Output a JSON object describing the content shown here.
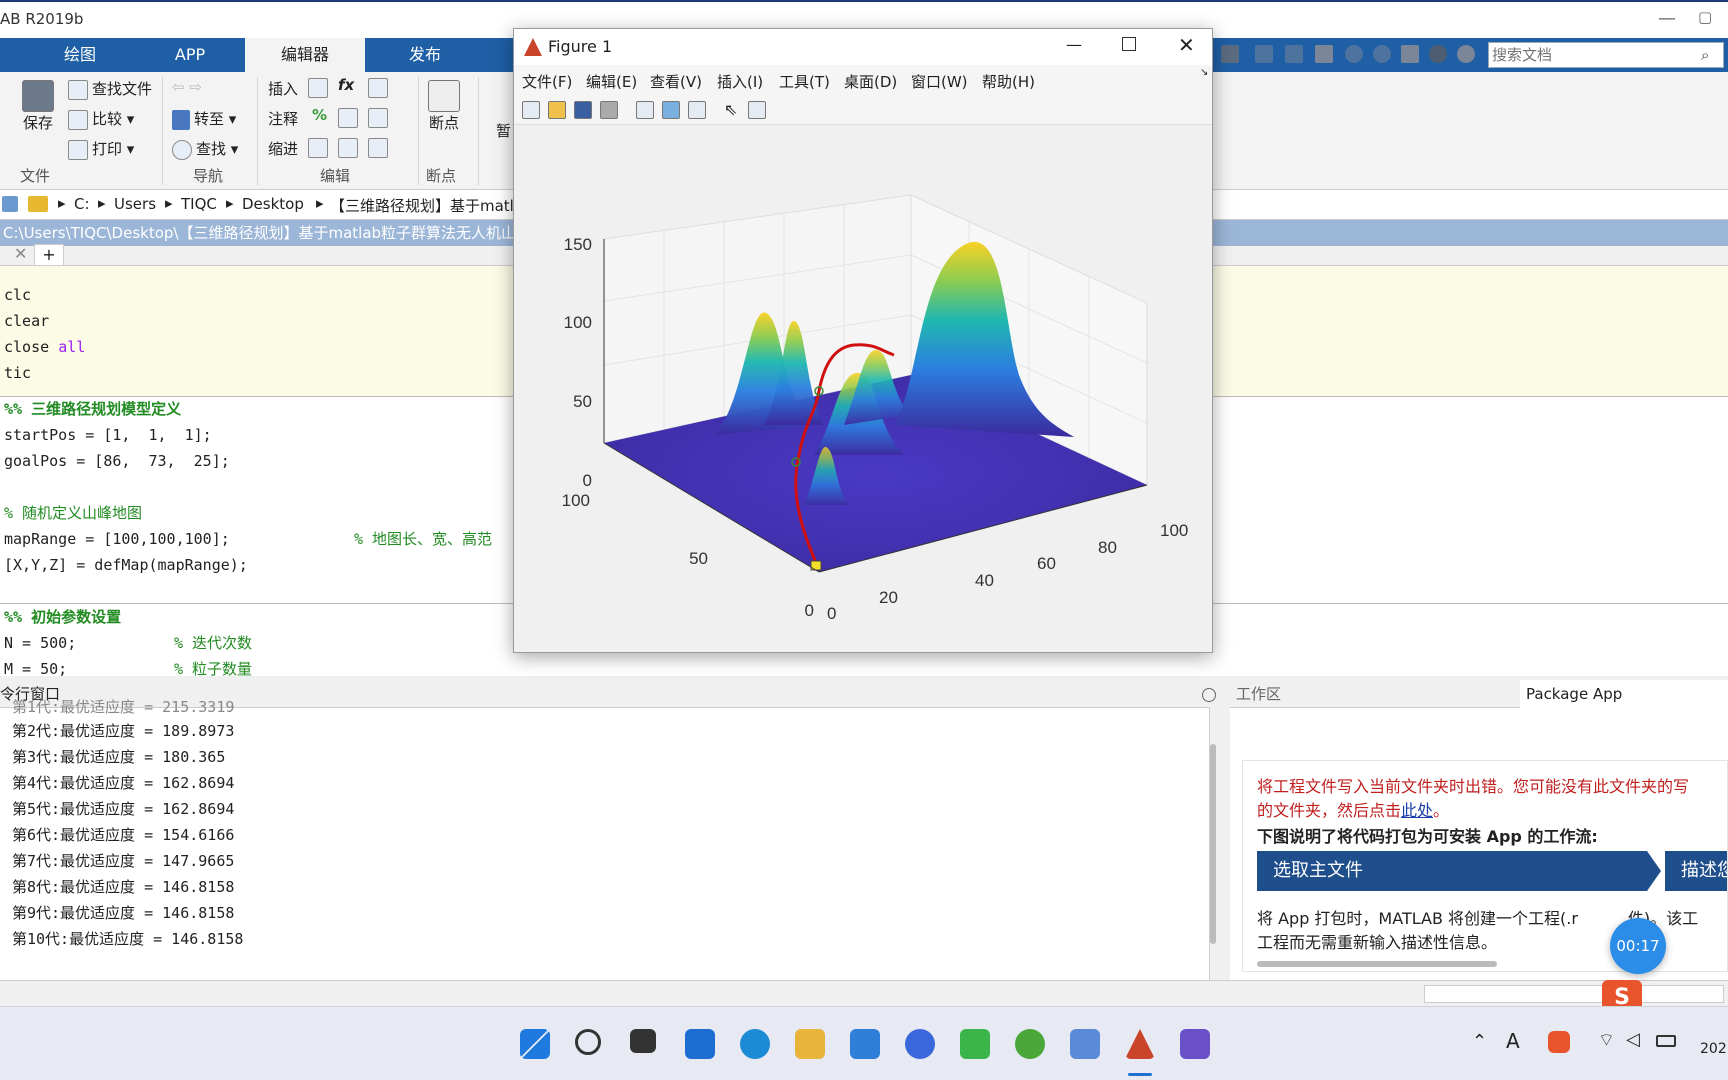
{
  "app": {
    "title": "AB R2019b",
    "min": "—",
    "max": "▢"
  },
  "ribbon_tabs": [
    "绘图",
    "APP",
    "编辑器",
    "发布"
  ],
  "ribbon": {
    "file": {
      "save": "保存",
      "find_file": "查找文件",
      "compare": "比较",
      "print": "打印",
      "group": "文件"
    },
    "nav": {
      "goto": "转至",
      "find": "查找",
      "group": "导航"
    },
    "edit": {
      "insert": "插入",
      "comment": "注释",
      "indent": "缩进",
      "fx": "fx",
      "percent": "%",
      "group": "编辑"
    },
    "breakpoints": {
      "label": "断点",
      "group": "断点"
    },
    "pause": "暂"
  },
  "quick_search": {
    "placeholder": "搜索文档"
  },
  "address": [
    "C:",
    "Users",
    "TIQC",
    "Desktop",
    "【三维路径规划】基于matla"
  ],
  "path": "C:\\Users\\TIQC\\Desktop\\【三维路径规划】基于matlab粒子群算法无人机山",
  "editor": {
    "cell1": [
      "clc",
      "clear",
      "close ",
      "tic"
    ],
    "all_kw": "all",
    "header1": "%% 三维路径规划模型定义",
    "l1": "startPos = [1,  1,  1];",
    "l2": "goalPos = [86,  73,  25];",
    "c1": "% 随机定义山峰地图",
    "l3": "mapRange = [100,100,100];",
    "c2": "% 地图长、宽、高范",
    "l4": "[X,Y,Z] = defMap(mapRange);",
    "header2": "%% 初始参数设置",
    "l5": "N = 500;",
    "c3": "% 迭代次数",
    "l6": "M = 50;",
    "c4": "% 粒子数量"
  },
  "cmd": {
    "title": "令行窗口",
    "lines": [
      "第1代:最优适应度 = 215.3319",
      "第2代:最优适应度 = 189.8973",
      "第3代:最优适应度 = 180.365",
      "第4代:最优适应度 = 162.8694",
      "第5代:最优适应度 = 162.8694",
      "第6代:最优适应度 = 154.6166",
      "第7代:最优适应度 = 147.9665",
      "第8代:最优适应度 = 146.8158",
      "第9代:最优适应度 = 146.8158",
      "第10代:最优适应度 = 146.8158"
    ]
  },
  "workspace": {
    "tab1": "工作区",
    "tab2": "Package App",
    "error": "将工程文件写入当前文件夹时出错。您可能没有此文件夹的写",
    "error2": "的文件夹，然后点击",
    "link": "此处",
    "period": "。",
    "heading": "下图说明了将代码打包为可安装 App 的工作流:",
    "step1": "选取主文件",
    "step2": "描述您",
    "desc1": "将 App 打包时，MATLAB 将创建一个工程(.r",
    "desc1b": "件)。该工",
    "desc2": "工程而无需重新输入描述性信息。"
  },
  "figure": {
    "title": "Figure 1",
    "menu": [
      "文件(F)",
      "编辑(E)",
      "查看(V)",
      "插入(I)",
      "工具(T)",
      "桌面(D)",
      "窗口(W)",
      "帮助(H)"
    ],
    "z_ticks": [
      "150",
      "100",
      "50",
      "0"
    ],
    "y_ticks": [
      "100",
      "50",
      "0"
    ],
    "x_ticks": [
      "0",
      "20",
      "40",
      "60",
      "80",
      "100"
    ]
  },
  "recording": "00:17",
  "tray": {
    "clock": "202"
  },
  "colors": {
    "ribbon": "#1f5fa5",
    "surface_low": "#3b2a9e",
    "surface_high": "#f9d125",
    "path": "#d01010"
  }
}
